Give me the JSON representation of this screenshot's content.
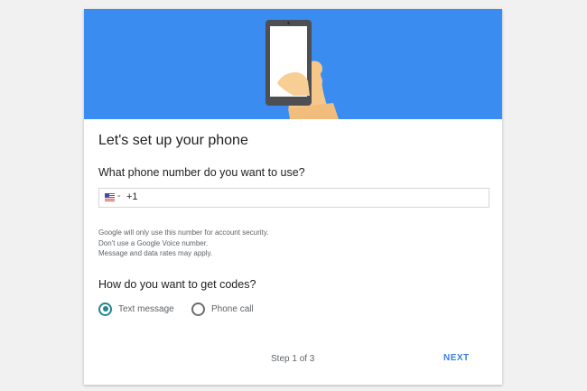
{
  "header": {
    "title": "Let's set up your phone"
  },
  "phone": {
    "question": "What phone number do you want to use?",
    "country_flag": "us-flag-icon",
    "dropdown_indicator": "-",
    "dial_code": "+1",
    "value": ""
  },
  "notice": {
    "line1": "Google will only use this number for account security.",
    "line2": "Don't use a Google Voice number.",
    "line3": "Message and data rates may apply."
  },
  "codes": {
    "question": "How do you want to get codes?",
    "options": [
      {
        "label": "Text message",
        "selected": true
      },
      {
        "label": "Phone call",
        "selected": false
      }
    ]
  },
  "footer": {
    "step": "Step 1 of 3",
    "next_label": "NEXT"
  },
  "colors": {
    "banner": "#3a8cf0",
    "accent_radio": "#26868e",
    "next_link": "#3a7fe0"
  }
}
